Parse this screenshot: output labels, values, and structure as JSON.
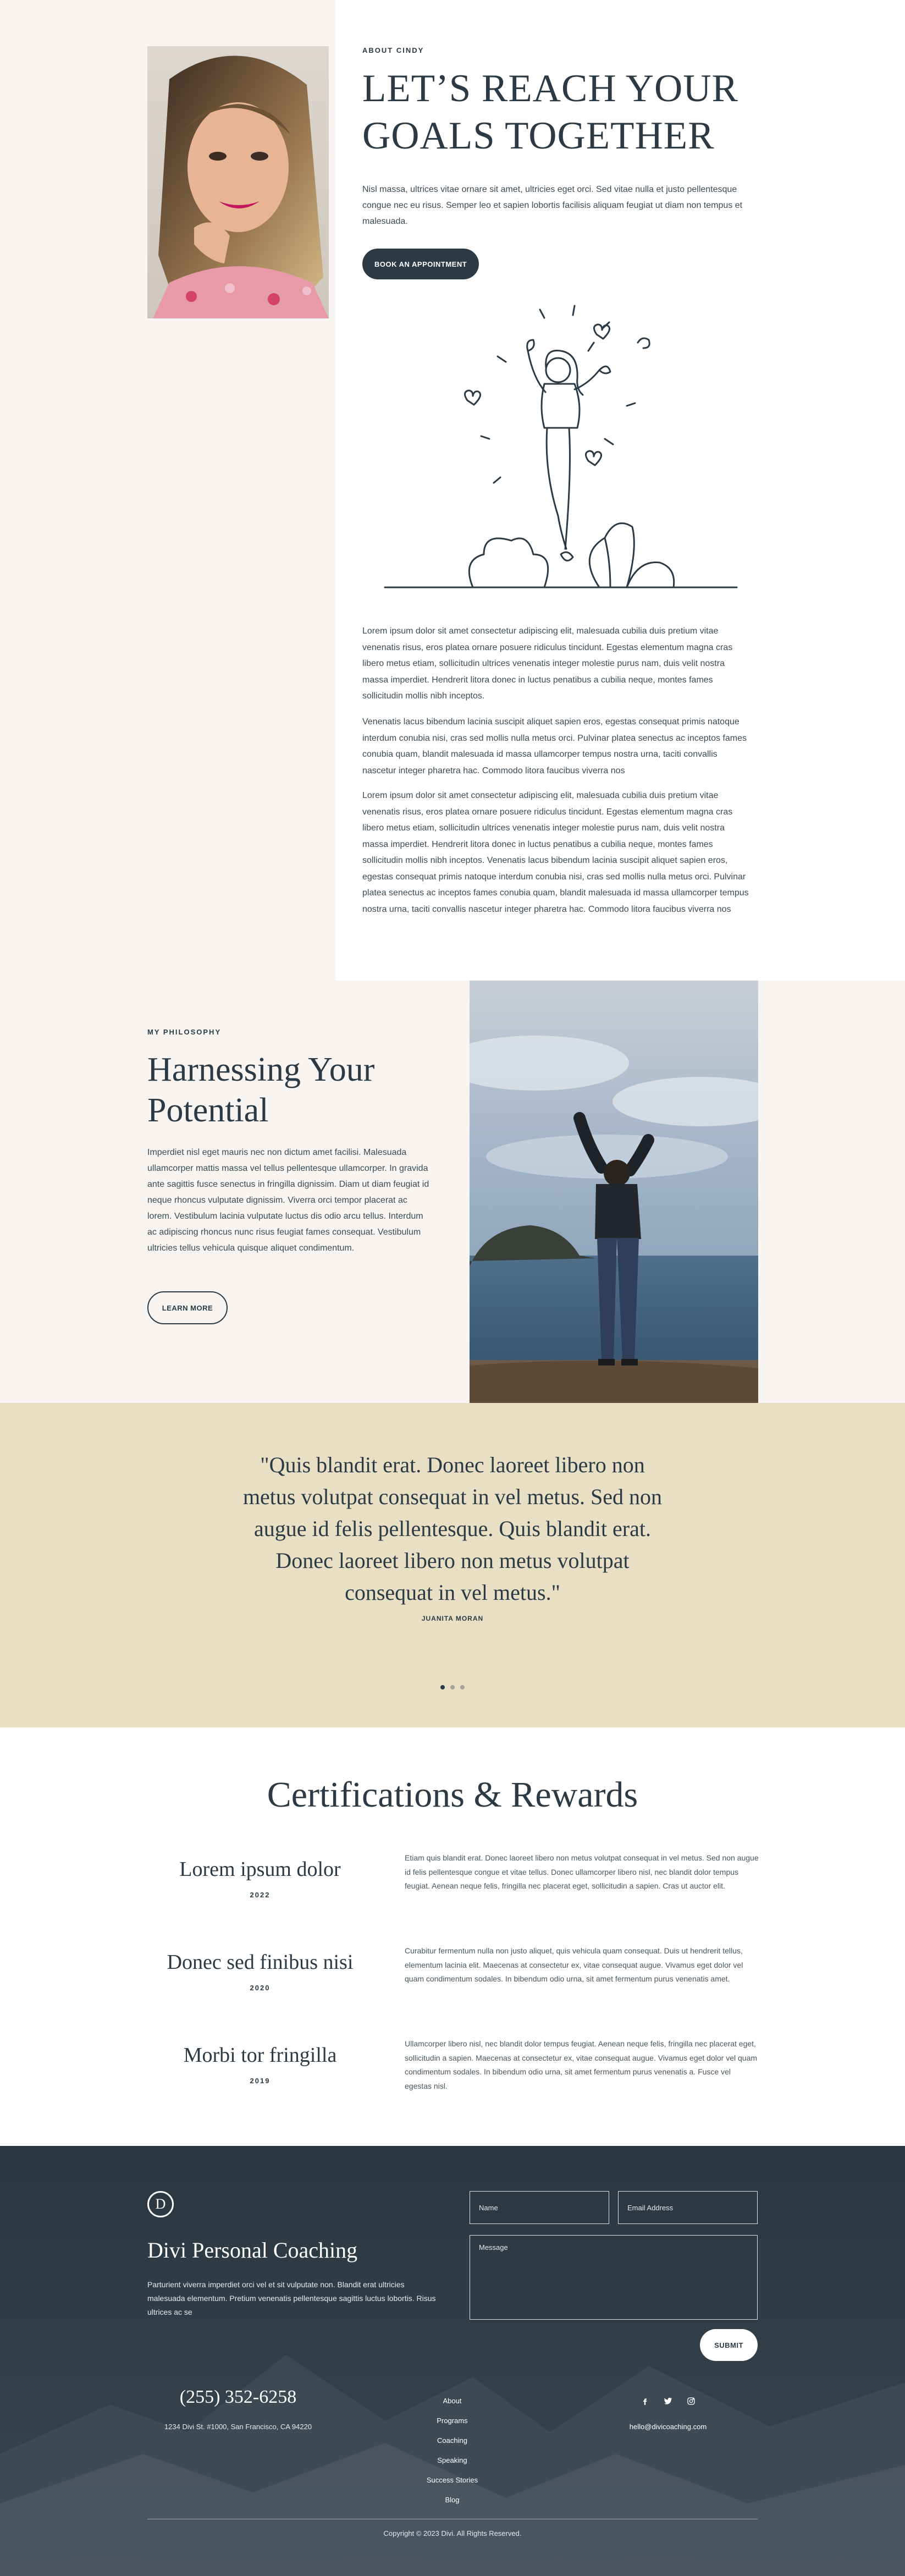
{
  "about": {
    "eyebrow": "ABOUT CINDY",
    "title": "LET’S REACH YOUR GOALS TOGETHER",
    "lead": "Nisl massa, ultrices vitae ornare sit amet, ultricies eget orci. Sed vitae nulla et justo pellentesque congue nec eu risus. Semper leo et sapien lobortis facilisis aliquam feugiat ut diam non tempus et malesuada.",
    "button": "BOOK AN APPOINTMENT",
    "paragraphs": [
      "Lorem ipsum dolor sit amet consectetur adipiscing elit, malesuada cubilia duis pretium vitae venenatis risus, eros platea ornare posuere ridiculus tincidunt. Egestas elementum magna cras libero metus etiam, sollicitudin ultrices venenatis integer molestie purus nam, duis velit nostra massa imperdiet. Hendrerit litora donec in luctus penatibus a cubilia neque, montes fames sollicitudin mollis nibh inceptos.",
      "Venenatis lacus bibendum lacinia suscipit aliquet sapien eros, egestas consequat primis natoque interdum conubia nisi, cras sed mollis nulla metus orci. Pulvinar platea senectus ac inceptos fames conubia quam, blandit malesuada id massa ullamcorper tempus nostra urna, taciti convallis nascetur integer pharetra hac. Commodo litora faucibus viverra nos",
      "Lorem ipsum dolor sit amet consectetur adipiscing elit, malesuada cubilia duis pretium vitae venenatis risus, eros platea ornare posuere ridiculus tincidunt. Egestas elementum magna cras libero metus etiam, sollicitudin ultrices venenatis integer molestie purus nam, duis velit nostra massa imperdiet. Hendrerit litora donec in luctus penatibus a cubilia neque, montes fames sollicitudin mollis nibh inceptos. Venenatis lacus bibendum lacinia suscipit aliquet sapien eros, egestas consequat primis natoque interdum conubia nisi, cras sed mollis nulla metus orci. Pulvinar platea senectus ac inceptos fames conubia quam, blandit malesuada id massa ullamcorper tempus nostra urna, taciti convallis nascetur integer pharetra hac. Commodo litora faucibus viverra nos"
    ]
  },
  "philosophy": {
    "eyebrow": "MY PHILOSOPHY",
    "title": "Harnessing Your Potential",
    "body": "Imperdiet nisl eget mauris nec non dictum amet facilisi. Malesuada ullamcorper mattis massa vel tellus pellentesque ullamcorper. In gravida ante sagittis fusce senectus in fringilla dignissim. Diam ut diam feugiat id neque rhoncus vulputate dignissim. Viverra orci tempor placerat ac lorem. Vestibulum lacinia vulputate luctus dis odio arcu tellus. Interdum ac adipiscing rhoncus nunc risus feugiat fames consequat. Vestibulum ultricies tellus vehicula quisque aliquet condimentum.",
    "button": "LEARN MORE"
  },
  "testimonial": {
    "quote": "\"Quis blandit erat. Donec laoreet libero non metus volutpat consequat in vel metus. Sed non augue id felis pellentesque. Quis blandit erat. Donec laoreet libero non metus volutpat consequat in vel metus.\"",
    "author": "JUANITA MORAN",
    "slides": 3,
    "active_slide": 1
  },
  "certifications": {
    "title": "Certifications & Rewards",
    "items": [
      {
        "title": "Lorem ipsum dolor",
        "year": "2022",
        "desc": "Etiam quis blandit erat. Donec laoreet libero non metus volutpat consequat in vel metus. Sed non augue id felis pellentesque congue et vitae tellus. Donec ullamcorper libero nisl, nec blandit dolor tempus feugiat. Aenean neque felis, fringilla nec placerat eget, sollicitudin a sapien. Cras ut auctor elit."
      },
      {
        "title": "Donec sed finibus nisi",
        "year": "2020",
        "desc": "Curabitur fermentum nulla non justo aliquet, quis vehicula quam consequat. Duis ut hendrerit tellus, elementum lacinia elit. Maecenas at consectetur ex, vitae consequat augue. Vivamus eget dolor vel quam condimentum sodales. In bibendum odio urna, sit amet fermentum purus venenatis amet."
      },
      {
        "title": "Morbi tor fringilla",
        "year": "2019",
        "desc": "Ullamcorper libero nisl, nec blandit dolor tempus feugiat. Aenean neque felis, fringilla nec placerat eget, sollicitudin a sapien. Maecenas at consectetur ex, vitae consequat augue. Vivamus eget dolor vel quam condimentum sodales. In bibendum odio urna, sit amet fermentum purus venenatis a. Fusce vel egestas nisl."
      }
    ]
  },
  "footer": {
    "logo_letter": "D",
    "brand": "Divi Personal Coaching",
    "description": "Parturient viverra imperdiet orci vel et sit vulputate non. Blandit erat ultricies malesuada elementum. Pretium venenatis pellentesque sagittis luctus lobortis. Risus ultrices ac se",
    "form": {
      "name_placeholder": "Name",
      "email_placeholder": "Email Address",
      "message_placeholder": "Message",
      "submit": "SUBMIT"
    },
    "phone": "(255) 352-6258",
    "address": "1234 Divi St. #1000, San Francisco, CA 94220",
    "nav": [
      "About",
      "Programs",
      "Coaching",
      "Speaking",
      "Success Stories",
      "Blog"
    ],
    "socials": [
      "facebook-icon",
      "twitter-icon",
      "instagram-icon"
    ],
    "email": "hello@divicoaching.com",
    "copyright": "Copyright © 2023 Divi. All Rights Reserved."
  },
  "colors": {
    "navy": "#2b3a44",
    "cream": "#f7f4f1",
    "sand": "#e8dfc5",
    "white": "#ffffff"
  }
}
